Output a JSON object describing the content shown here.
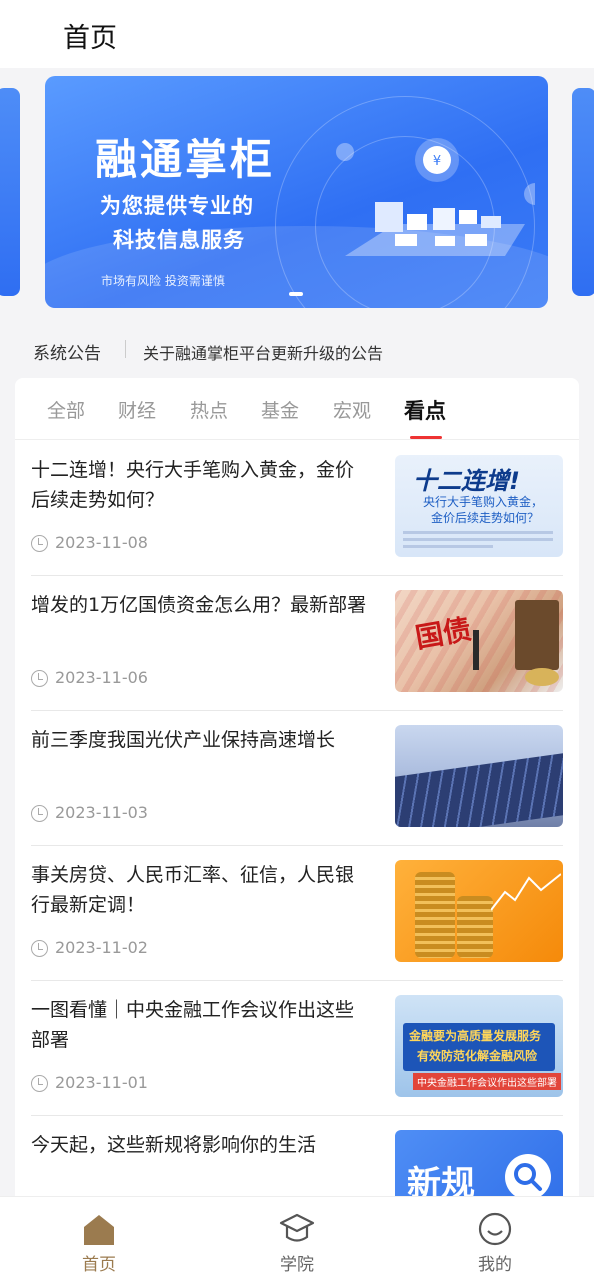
{
  "header": {
    "title": "首页"
  },
  "banner": {
    "headline": "融通掌柜",
    "line1": "为您提供专业的",
    "line2": "科技信息服务",
    "risk_note": "市场有风险 投资需谨慎"
  },
  "notice": {
    "label": "系统公告",
    "text": "关于融通掌柜平台更新升级的公告"
  },
  "tabs": [
    {
      "label": "全部"
    },
    {
      "label": "财经"
    },
    {
      "label": "热点"
    },
    {
      "label": "基金"
    },
    {
      "label": "宏观"
    },
    {
      "label": "看点",
      "active": true
    }
  ],
  "articles": [
    {
      "title": "十二连增！央行大手笔购入黄金，金价后续走势如何？",
      "date": "2023-11-08",
      "thumb": {
        "big": "十二连增!",
        "sub1": "央行大手笔购入黄金，",
        "sub2": "金价后续走势如何？"
      }
    },
    {
      "title": "增发的1万亿国债资金怎么用？最新部署",
      "date": "2023-11-06",
      "thumb": {
        "big": "国债"
      }
    },
    {
      "title": "前三季度我国光伏产业保持高速增长",
      "date": "2023-11-03",
      "thumb": {}
    },
    {
      "title": "事关房贷、人民币汇率、征信，人民银行最新定调！",
      "date": "2023-11-02",
      "thumb": {}
    },
    {
      "title": "一图看懂｜中央金融工作会议作出这些部署",
      "date": "2023-11-01",
      "thumb": {
        "line1": "金融要为高质量发展服务",
        "line2": "有效防范化解金融风险",
        "line3": "中央金融工作会议作出这些部署"
      }
    },
    {
      "title": "今天起，这些新规将影响你的生活",
      "date": "",
      "thumb": {
        "big": "新规"
      }
    }
  ],
  "tabbar": [
    {
      "label": "首页",
      "icon": "home-icon",
      "active": true
    },
    {
      "label": "学院",
      "icon": "graduation-cap-icon"
    },
    {
      "label": "我的",
      "icon": "smile-icon"
    }
  ],
  "colors": {
    "accent": "#9b7b4f",
    "tab_underline": "#ee3333",
    "banner_blue": "#2f6ff3"
  }
}
